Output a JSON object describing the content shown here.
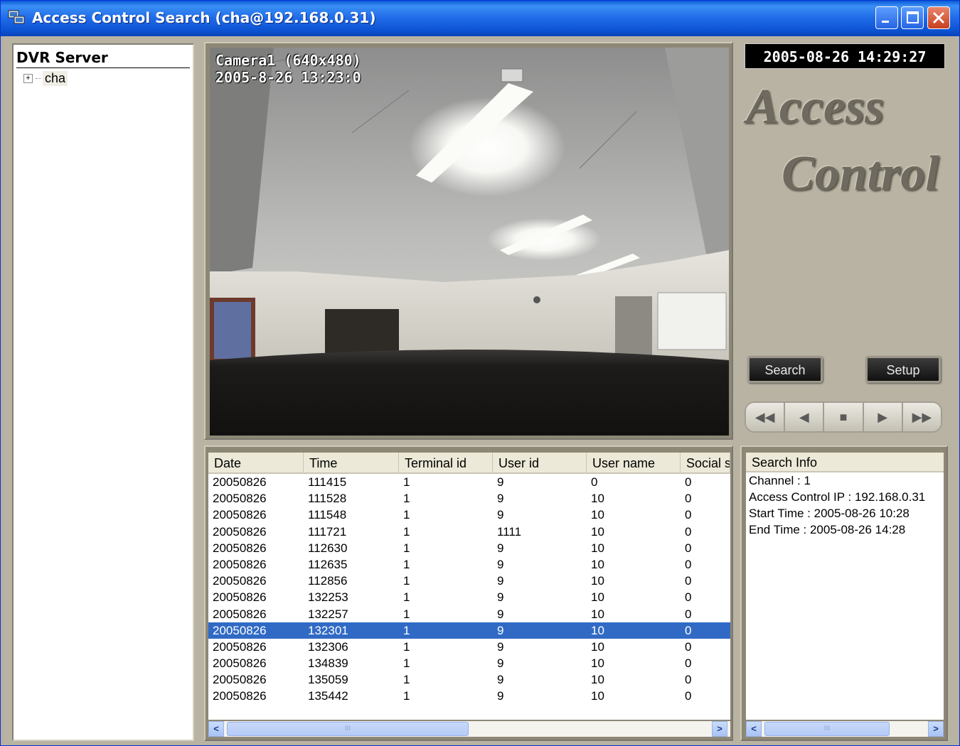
{
  "window": {
    "title": "Access Control Search (cha@192.168.0.31)"
  },
  "tree": {
    "header": "DVR Server",
    "nodes": [
      {
        "label": "cha",
        "expander": "+"
      }
    ]
  },
  "video": {
    "camera_label": "Camera1 (640x480)",
    "timestamp": "2005-8-26 13:23:0"
  },
  "clock": "2005-08-26 14:29:27",
  "logo": {
    "line1": "Access",
    "line2": "Control"
  },
  "buttons": {
    "search": "Search",
    "setup": "Setup"
  },
  "transport": {
    "icons": [
      "fast-rewind-icon",
      "rewind-icon",
      "stop-icon",
      "play-icon",
      "fast-forward-icon"
    ],
    "glyphs": [
      "◀◀",
      "◀",
      "■",
      "▶",
      "▶▶"
    ]
  },
  "table": {
    "columns": [
      "Date",
      "Time",
      "Terminal id",
      "User id",
      "User name",
      "Social s"
    ],
    "selected_index": 9,
    "rows": [
      [
        "20050826",
        "111415",
        "1",
        "9",
        "0",
        "0"
      ],
      [
        "20050826",
        "111528",
        "1",
        "9",
        "10",
        "0"
      ],
      [
        "20050826",
        "111548",
        "1",
        "9",
        "10",
        "0"
      ],
      [
        "20050826",
        "111721",
        "1",
        "1111",
        "10",
        "0"
      ],
      [
        "20050826",
        "112630",
        "1",
        "9",
        "10",
        "0"
      ],
      [
        "20050826",
        "112635",
        "1",
        "9",
        "10",
        "0"
      ],
      [
        "20050826",
        "112856",
        "1",
        "9",
        "10",
        "0"
      ],
      [
        "20050826",
        "132253",
        "1",
        "9",
        "10",
        "0"
      ],
      [
        "20050826",
        "132257",
        "1",
        "9",
        "10",
        "0"
      ],
      [
        "20050826",
        "132301",
        "1",
        "9",
        "10",
        "0"
      ],
      [
        "20050826",
        "132306",
        "1",
        "9",
        "10",
        "0"
      ],
      [
        "20050826",
        "134839",
        "1",
        "9",
        "10",
        "0"
      ],
      [
        "20050826",
        "135059",
        "1",
        "9",
        "10",
        "0"
      ],
      [
        "20050826",
        "135442",
        "1",
        "9",
        "10",
        "0"
      ]
    ]
  },
  "search_info": {
    "header": "Search Info",
    "lines": [
      "Channel : 1",
      "Access Control IP : 192.168.0.31",
      "Start Time : 2005-08-26 10:28",
      "End Time : 2005-08-26 14:28"
    ]
  },
  "scroll": {
    "left_arrow": "<",
    "right_arrow": ">",
    "thumb_grip": "III"
  }
}
